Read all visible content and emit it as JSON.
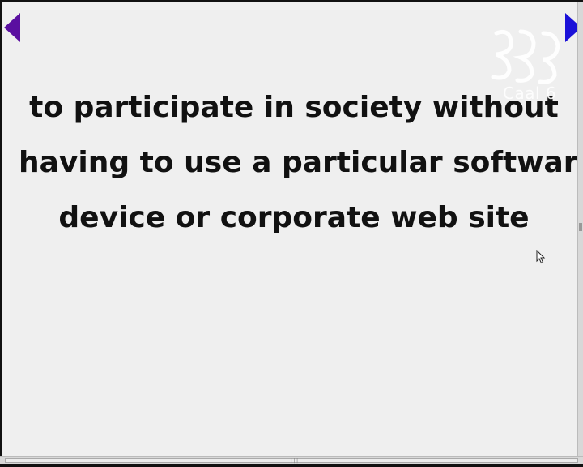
{
  "slide": {
    "lines": [
      "to participate in society without",
      "having to use a particular software,",
      "device or corporate web site"
    ]
  },
  "navigation": {
    "prev_icon": "triangle-left-icon",
    "next_icon": "triangle-right-icon",
    "prev_color": "#5a0fa0",
    "next_color": "#1a10d8"
  },
  "logo": {
    "icon": "logo-mark",
    "caption": "Caal 6"
  },
  "colors": {
    "slide_background": "#efefef",
    "text": "#111111"
  }
}
